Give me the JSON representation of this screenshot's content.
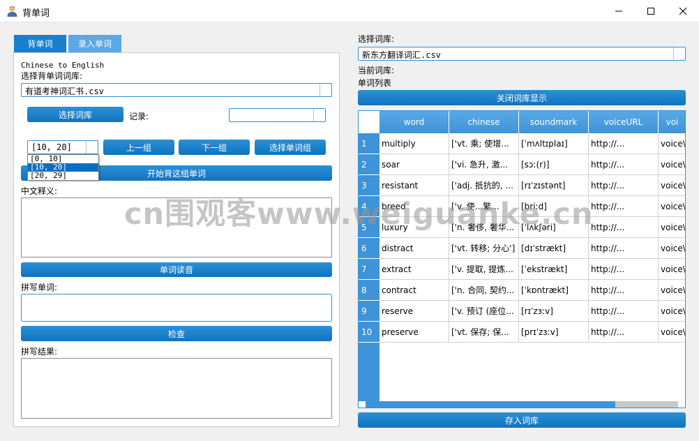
{
  "window": {
    "title": "背单词",
    "icon": "person-icon"
  },
  "tabs": [
    {
      "label": "背单词",
      "active": true
    },
    {
      "label": "录入单词",
      "active": false
    }
  ],
  "left": {
    "mode_text": "Chinese to English",
    "choose_lib_label": "选择背单词词库:",
    "lib_value": "有道考神词汇书.csv",
    "choose_lib_button": "选择词库",
    "record_label": "记录:",
    "record_value": "",
    "group_value": "[10, 20]",
    "group_options": [
      "[0, 10]",
      "[10, 20]",
      "[20, 29]"
    ],
    "group_selected_index": 1,
    "prev_group_button": "上一组",
    "next_group_button": "下一组",
    "choose_group_button": "选择单词组",
    "start_button": "开始背这组单词",
    "meaning_label": "中文释义:",
    "meaning_text": "",
    "read_button": "单词读音",
    "spell_label": "拼写单词:",
    "spell_value": "",
    "check_button": "检查",
    "result_label": "拼写结果:",
    "result_text": ""
  },
  "right": {
    "choose_lib_label": "选择词库:",
    "lib_value": "新东方翻译词汇.csv",
    "current_lib_label": "当前词库:",
    "current_lib_value": "",
    "word_list_label": "单词列表",
    "close_button": "关闭词库显示",
    "save_button": "存入词库",
    "table": {
      "columns": [
        "word",
        "chinese",
        "soundmark",
        "voiceURL",
        "voi"
      ],
      "rows": [
        {
          "n": "1",
          "word": "multiply",
          "chinese": "['vt. 乘; 使增...",
          "soundmark": "[ˈmʌltɪplaɪ]",
          "voiceURL": "http://...",
          "voice": "voice\\"
        },
        {
          "n": "2",
          "word": "soar",
          "chinese": "['vi. 急升, 激...",
          "soundmark": "[sɔː(r)]",
          "voiceURL": "http://...",
          "voice": "voice\\"
        },
        {
          "n": "3",
          "word": "resistant",
          "chinese": "['adj. 抵抗的, ...",
          "soundmark": "[rɪˈzɪstənt]",
          "voiceURL": "http://...",
          "voice": "voice\\"
        },
        {
          "n": "4",
          "word": "breed",
          "chinese": "['v. 使...繁...",
          "soundmark": "[briːd]",
          "voiceURL": "http://...",
          "voice": "voice\\"
        },
        {
          "n": "5",
          "word": "luxury",
          "chinese": "['n. 奢侈, 奢华...",
          "soundmark": "[ˈlʌkʃəri]",
          "voiceURL": "http://...",
          "voice": "voice\\"
        },
        {
          "n": "6",
          "word": "distract",
          "chinese": "['vt. 转移; 分心']",
          "soundmark": "[dɪˈstrækt]",
          "voiceURL": "http://...",
          "voice": "voice\\"
        },
        {
          "n": "7",
          "word": "extract",
          "chinese": "['v. 提取, 提炼...",
          "soundmark": "[ˈekstrækt]",
          "voiceURL": "http://...",
          "voice": "voice\\"
        },
        {
          "n": "8",
          "word": "contract",
          "chinese": "['n. 合同, 契约...",
          "soundmark": "[ˈkɒntrækt]",
          "voiceURL": "http://...",
          "voice": "voice\\"
        },
        {
          "n": "9",
          "word": "reserve",
          "chinese": "['v. 预订 (座位...",
          "soundmark": "[rɪˈzɜːv]",
          "voiceURL": "http://...",
          "voice": "voice\\"
        },
        {
          "n": "10",
          "word": "preserve",
          "chinese": "['vt. 保存; 保...",
          "soundmark": "[prɪˈzɜːv]",
          "voiceURL": "http://...",
          "voice": "voice\\"
        }
      ],
      "scroll_fraction": 0.8
    }
  },
  "watermark": "cn围观客www.weiguanke.cn",
  "colors": {
    "accent": "#1a7fcc",
    "header": "#3f93d8",
    "tab_active": "#1a7fcc",
    "tab_inactive": "#5aa8e6"
  }
}
